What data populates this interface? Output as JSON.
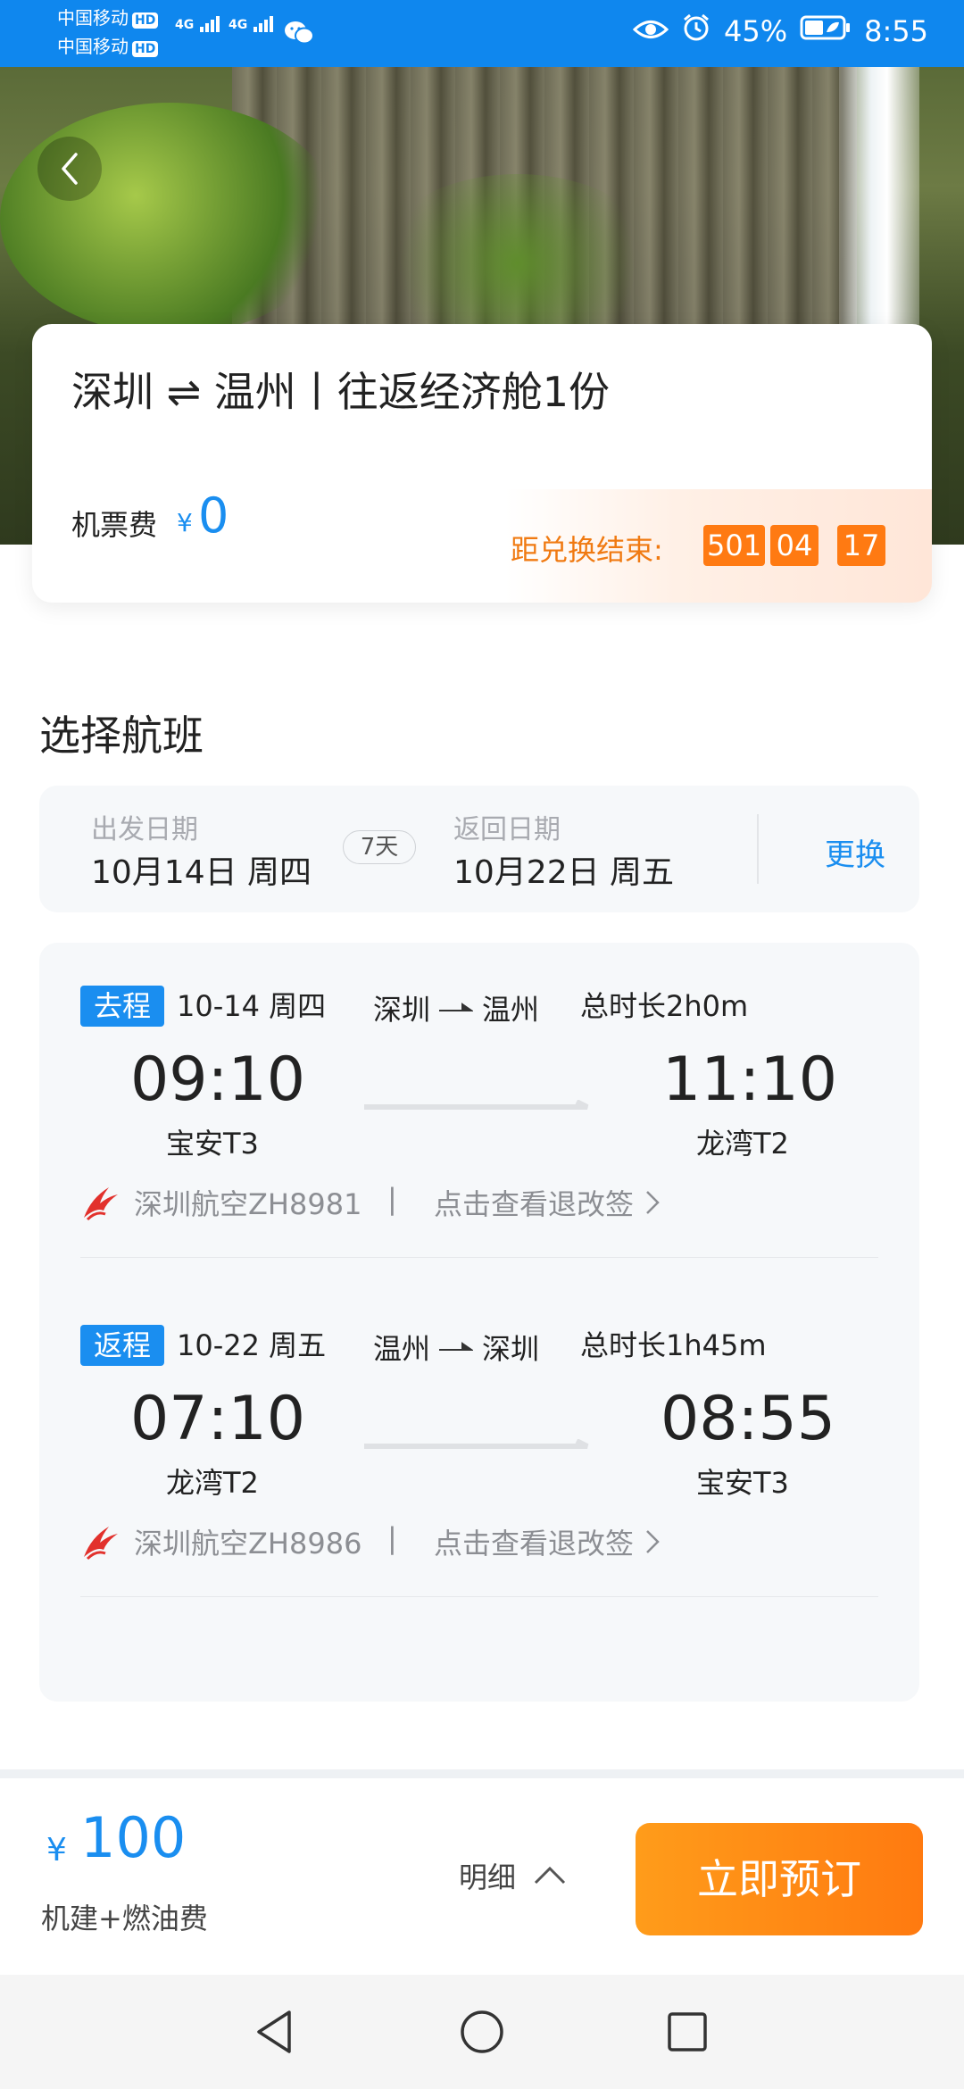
{
  "status_bar": {
    "carrier_1": "中国移动",
    "carrier_2": "中国移动",
    "hd_label": "HD",
    "network": "4G",
    "battery": "45%",
    "time": "8:55"
  },
  "summary": {
    "title": "深圳 ⇌ 温州丨往返经济舱1份",
    "fee_label": "机票费",
    "currency": "¥",
    "fee_value": "0",
    "countdown_label": "距兑换结束:",
    "countdown": [
      "501",
      "04",
      "17"
    ]
  },
  "section_title": "选择航班",
  "dates": {
    "depart_label": "出发日期",
    "depart_value": "10月14日 周四",
    "days": "7天",
    "return_label": "返回日期",
    "return_value": "10月22日 周五",
    "change": "更换"
  },
  "legs": [
    {
      "badge": "去程",
      "date": "10-14 周四",
      "from": "深圳",
      "to": "温州",
      "duration": "总时长2h0m",
      "dep_time": "09:10",
      "dep_airport": "宝安T3",
      "arr_time": "11:10",
      "arr_airport": "龙湾T2",
      "airline": "深圳航空ZH8981",
      "separator": "|",
      "refund": "点击查看退改签"
    },
    {
      "badge": "返程",
      "date": "10-22 周五",
      "from": "温州",
      "to": "深圳",
      "duration": "总时长1h45m",
      "dep_time": "07:10",
      "dep_airport": "龙湾T2",
      "arr_time": "08:55",
      "arr_airport": "宝安T3",
      "airline": "深圳航空ZH8986",
      "separator": "|",
      "refund": "点击查看退改签"
    }
  ],
  "bottom": {
    "currency": "¥",
    "price": "100",
    "price_note": "机建+燃油费",
    "detail": "明细",
    "book": "立即预订"
  },
  "colors": {
    "brand_blue": "#1a8ef0",
    "status_blue": "#0f87ee",
    "countdown_orange": "#ff7a12",
    "book_gradient": [
      "#ff9c1a",
      "#ff7a10"
    ],
    "airline_red": "#e2312c"
  },
  "icons": [
    "back-icon",
    "eye-icon",
    "alarm-icon",
    "battery-icon",
    "wechat-icon",
    "signal-icon",
    "route-arrow-icon",
    "chevron-right-icon",
    "chevron-up-icon",
    "airline-logo-icon",
    "nav-back-icon",
    "nav-home-icon",
    "nav-recent-icon"
  ]
}
